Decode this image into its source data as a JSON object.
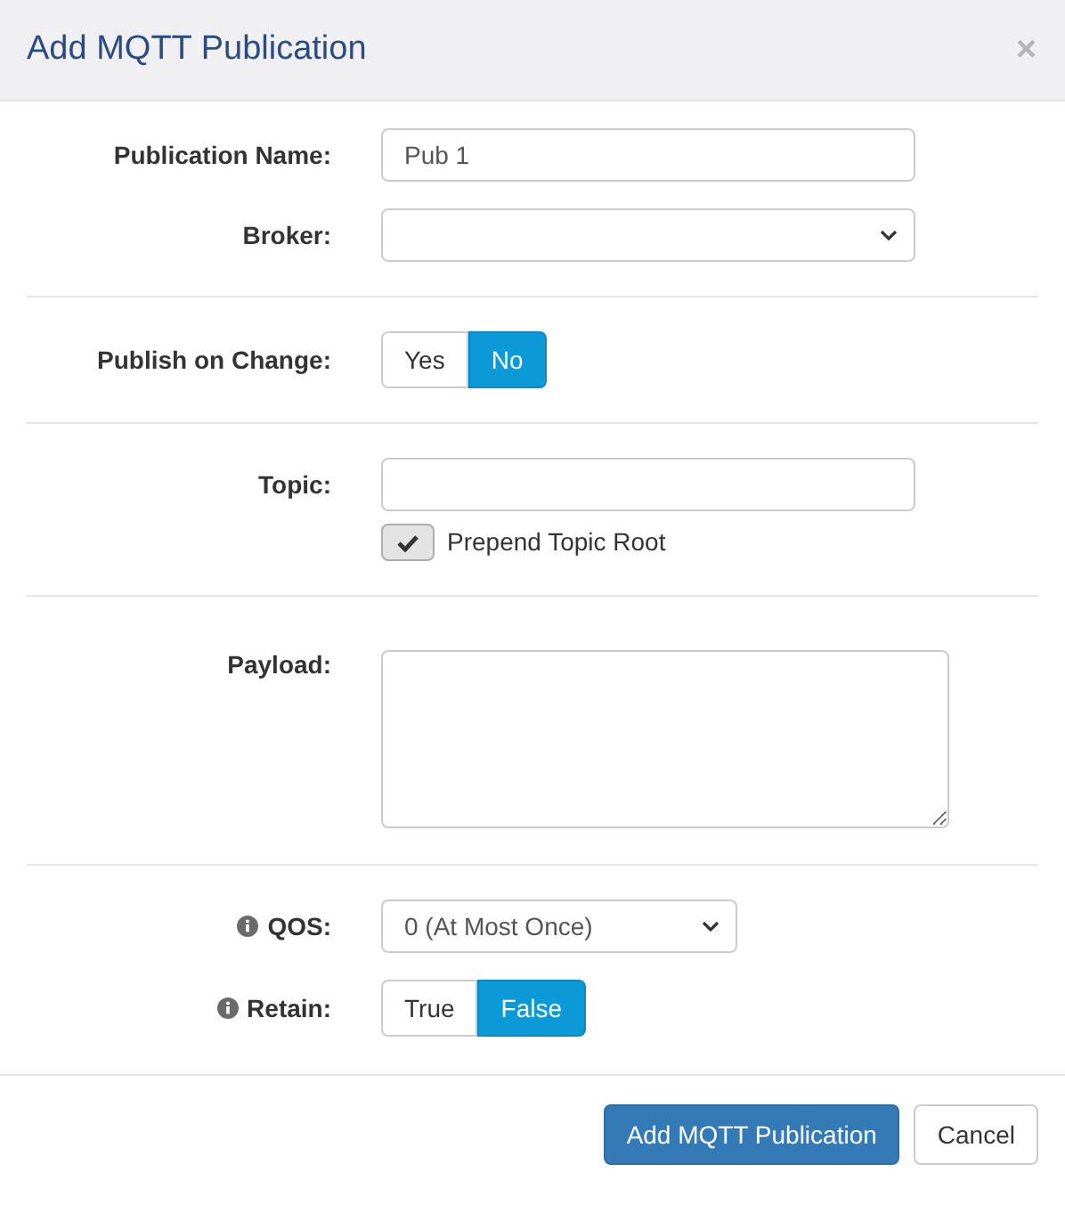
{
  "dialog": {
    "title": "Add MQTT Publication",
    "close": "×"
  },
  "sections": [
    [
      {
        "kind": "text",
        "label": "Publication Name:",
        "value": "Pub 1"
      },
      {
        "kind": "select",
        "label": "Broker:"
      }
    ],
    [
      {
        "kind": "toggle",
        "label": "Publish on Change:",
        "options": [
          {
            "label": "Yes",
            "selected": false
          },
          {
            "label": "No",
            "selected": true
          }
        ]
      }
    ],
    [
      {
        "kind": "text",
        "label": "Topic:"
      },
      {
        "kind": "checkbox",
        "text": "Prepend Topic Root",
        "checked": true
      }
    ],
    [
      {
        "kind": "textarea",
        "label": "Payload:"
      }
    ],
    [
      {
        "kind": "select",
        "label": "QOS:",
        "info": true,
        "value": "0 (At Most Once)"
      },
      {
        "kind": "toggle",
        "label": "Retain:",
        "info": true,
        "options": [
          {
            "label": "True",
            "selected": false
          },
          {
            "label": "False",
            "selected": true
          }
        ]
      }
    ]
  ],
  "footer": {
    "buttons": [
      {
        "label": "Add MQTT Publication",
        "kind": "primary"
      },
      {
        "label": "Cancel",
        "kind": "default"
      }
    ]
  }
}
